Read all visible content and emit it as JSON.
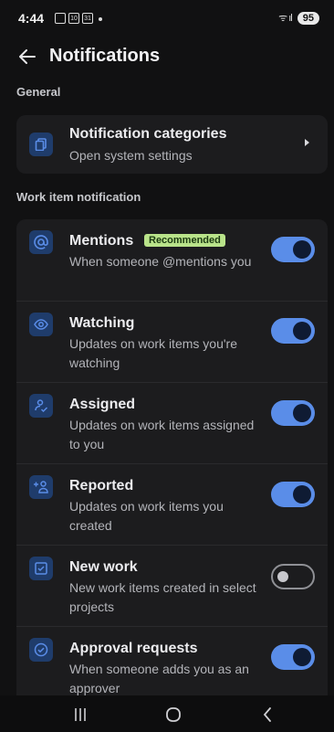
{
  "status_bar": {
    "time": "4:44",
    "mini_icons": [
      "",
      "10",
      "31"
    ],
    "signal": "ᯤ ıl",
    "battery": "95"
  },
  "header": {
    "title": "Notifications"
  },
  "sections": {
    "general": "General",
    "work_item": "Work item notification"
  },
  "categories": {
    "title": "Notification categories",
    "subtitle": "Open system settings",
    "icon": "copy-icon"
  },
  "items": [
    {
      "title": "Mentions",
      "badge": "Recommended",
      "desc": "When someone @mentions you",
      "icon": "at-icon",
      "enabled": true
    },
    {
      "title": "Watching",
      "desc": "Updates on work items you're watching",
      "icon": "eye-icon",
      "enabled": true
    },
    {
      "title": "Assigned",
      "desc": "Updates on work items assigned to you",
      "icon": "assigned-user-icon",
      "enabled": true
    },
    {
      "title": "Reported",
      "desc": "Updates on work items you created",
      "icon": "add-user-icon",
      "enabled": true
    },
    {
      "title": "New work",
      "desc": "New work items created in select projects",
      "icon": "checkbox-icon",
      "enabled": false
    },
    {
      "title": "Approval requests",
      "desc": "When someone adds you as an approver",
      "icon": "check-circle-icon",
      "enabled": true
    }
  ],
  "colors": {
    "accent": "#5a8de8",
    "badge_bg": "#b9e38a",
    "icon_bg": "#1f3c6b"
  },
  "nav": {
    "recents": "recents-icon",
    "home": "home-icon",
    "back": "back-icon"
  }
}
